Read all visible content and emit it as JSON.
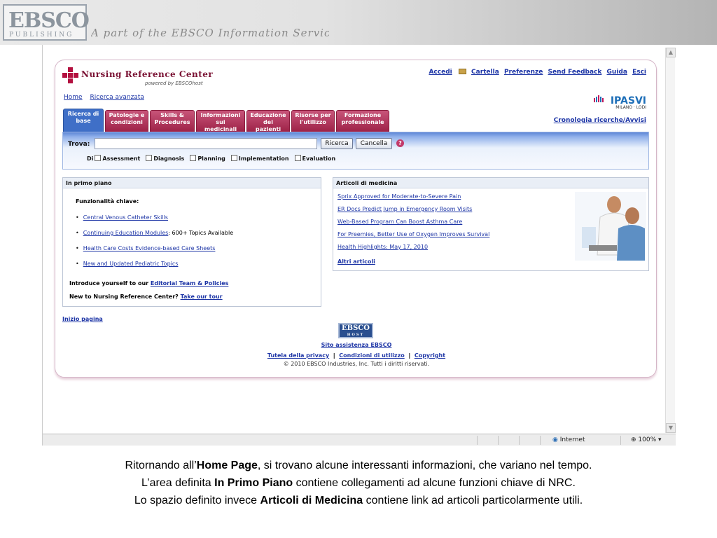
{
  "banner": {
    "logo_main": "EBSCO",
    "logo_sub": "PUBLISHING",
    "tagline": "A part of the EBSCO Information Services"
  },
  "site": {
    "title": "Nursing Reference Center",
    "powered_by": "powered by EBSCOhost"
  },
  "topnav": {
    "accedi": "Accedi",
    "cartella": "Cartella",
    "preferenze": "Preferenze",
    "feedback": "Send Feedback",
    "guida": "Guida",
    "esci": "Esci"
  },
  "breadcrumb": {
    "home": "Home",
    "advanced": "Ricerca avanzata"
  },
  "partner": {
    "name": "IPASVI",
    "sub": "MILANO · LODI"
  },
  "history_link": "Cronologia ricerche/Avvisi",
  "tabs": [
    {
      "line1": "Ricerca di",
      "line2": "base",
      "line3": ""
    },
    {
      "line1": "Patologie e",
      "line2": "condizioni",
      "line3": ""
    },
    {
      "line1": "Skills &",
      "line2": "Procedures",
      "line3": ""
    },
    {
      "line1": "Informazioni",
      "line2": "sui",
      "line3": "medicinali"
    },
    {
      "line1": "Educazione",
      "line2": "dei",
      "line3": "pazienti"
    },
    {
      "line1": "Risorse per",
      "line2": "l'utilizzo",
      "line3": ""
    },
    {
      "line1": "Formazione",
      "line2": "professionale",
      "line3": ""
    }
  ],
  "search": {
    "label": "Trova:",
    "value": "",
    "search_button": "Ricerca",
    "cancel_button": "Cancella",
    "help": "?",
    "filter_prefix": "Di",
    "filters": [
      "Assessment",
      "Diagnosis",
      "Planning",
      "Implementation",
      "Evaluation"
    ]
  },
  "in_primo_piano": {
    "heading": "In primo piano",
    "subheading": "Funzionalità chiave:",
    "items": [
      {
        "link": "Central Venous Catheter Skills",
        "suffix": ""
      },
      {
        "link": "Continuing Education Modules",
        "suffix": ": 600+ Topics Available"
      },
      {
        "link": "Health Care Costs Evidence-based Care Sheets",
        "suffix": ""
      },
      {
        "link": "New and Updated Pediatric Topics",
        "suffix": ""
      }
    ],
    "intro1_text": "Introduce yourself to our ",
    "intro1_link": "Editorial Team & Policies",
    "intro2_text": "New to Nursing Reference Center? ",
    "intro2_link": "Take our tour"
  },
  "articoli": {
    "heading": "Articoli di medicina",
    "items": [
      "Sprix Approved for Moderate-to-Severe Pain",
      "ER Docs Predict Jump in Emergency Room Visits",
      "Web-Based Program Can Boost Asthma Care",
      "For Preemies, Better Use of Oxygen Improves Survival",
      "Health Highlights: May 17, 2010"
    ],
    "more": "Altri articoli"
  },
  "footer": {
    "top_link": "Inizio pagina",
    "logo_main": "EBSCO",
    "logo_host": "HOST",
    "support": "Sito assistenza EBSCO",
    "privacy": "Tutela della privacy",
    "terms": "Condizioni di utilizzo",
    "copyright_link": "Copyright",
    "copyright_text": "© 2010 EBSCO Industries, Inc. Tutti i diritti riservati."
  },
  "statusbar": {
    "zone": "Internet",
    "zoom": "100%"
  },
  "caption": {
    "line1_pre": "Ritornando all’",
    "line1_bold": "Home Page",
    "line1_post": ", si trovano alcune interessanti informazioni, che variano nel tempo.",
    "line2_pre": "L’area definita ",
    "line2_bold": "In Primo Piano",
    "line2_post": " contiene collegamenti ad alcune funzioni chiave di NRC.",
    "line3_pre": "Lo spazio definito invece ",
    "line3_bold": "Articoli di Medicina",
    "line3_post": " contiene link ad articoli particolarmente utili."
  },
  "colors": {
    "brand_maroon": "#9e2247",
    "active_tab_blue": "#3f6fc7",
    "link_blue": "#1d35a6"
  }
}
